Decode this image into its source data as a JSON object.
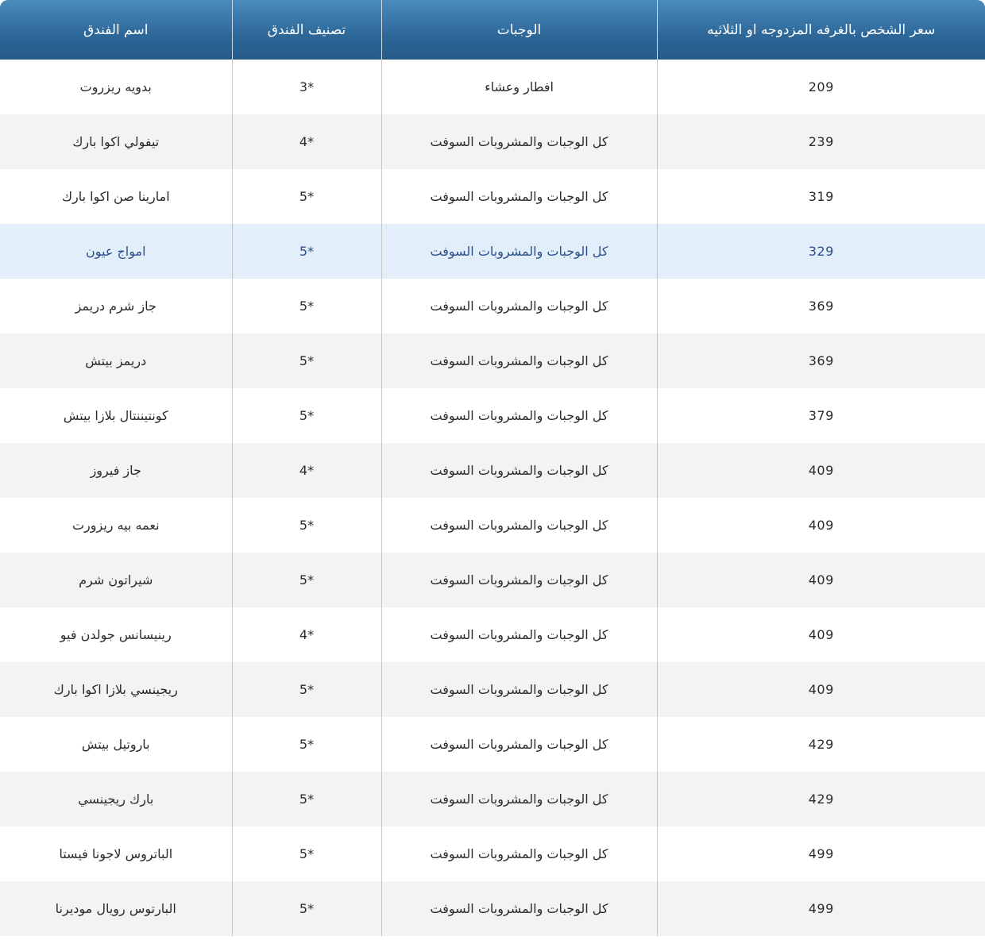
{
  "table": {
    "columns": [
      "سعر الشخص بالغرفه المزدوجه او الثلاثيه",
      "الوجبات",
      "تصنيف الفندق",
      "اسم الفندق"
    ],
    "highlighted_row": 3,
    "colors": {
      "header_top": "#4a8bbd",
      "header_bottom": "#245a88",
      "row_alt": "#f2f3f5",
      "row_highlight": "#e2eefa",
      "highlight_text": "#2a4f8a"
    },
    "rows": [
      {
        "price": "209",
        "meals": "افطار وعشاء",
        "rating": "3*",
        "hotel": "بدويه ريزروت"
      },
      {
        "price": "239",
        "meals": "كل الوجبات والمشروبات السوفت",
        "rating": "4*",
        "hotel": "تيفولي اكوا بارك"
      },
      {
        "price": "319",
        "meals": "كل الوجبات والمشروبات السوفت",
        "rating": "5*",
        "hotel": "امارينا صن اكوا بارك"
      },
      {
        "price": "329",
        "meals": "كل الوجبات والمشروبات السوفت",
        "rating": "5*",
        "hotel": "امواج عيون"
      },
      {
        "price": "369",
        "meals": "كل الوجبات والمشروبات السوفت",
        "rating": "5*",
        "hotel": "جاز شرم دريمز"
      },
      {
        "price": "369",
        "meals": "كل الوجبات والمشروبات السوفت",
        "rating": "5*",
        "hotel": "دريمز بيتش"
      },
      {
        "price": "379",
        "meals": "كل الوجبات والمشروبات السوفت",
        "rating": "5*",
        "hotel": "كونتيننتال بلازا بيتش"
      },
      {
        "price": "409",
        "meals": "كل الوجبات والمشروبات السوفت",
        "rating": "4*",
        "hotel": "جاز فيروز"
      },
      {
        "price": "409",
        "meals": "كل الوجبات والمشروبات السوفت",
        "rating": "5*",
        "hotel": "نعمه بيه ريزورت"
      },
      {
        "price": "409",
        "meals": "كل الوجبات والمشروبات السوفت",
        "rating": "5*",
        "hotel": "شيراتون شرم"
      },
      {
        "price": "409",
        "meals": "كل الوجبات والمشروبات السوفت",
        "rating": "4*",
        "hotel": "رينيسانس جولدن فيو"
      },
      {
        "price": "409",
        "meals": "كل الوجبات والمشروبات السوفت",
        "rating": "5*",
        "hotel": "ريجينسي بلازا اكوا بارك"
      },
      {
        "price": "429",
        "meals": "كل الوجبات والمشروبات السوفت",
        "rating": "5*",
        "hotel": "باروتيل بيتش"
      },
      {
        "price": "429",
        "meals": "كل الوجبات والمشروبات السوفت",
        "rating": "5*",
        "hotel": "بارك ريجينسي"
      },
      {
        "price": "499",
        "meals": "كل الوجبات والمشروبات السوفت",
        "rating": "5*",
        "hotel": "الباتروس لاجونا فيستا"
      },
      {
        "price": "499",
        "meals": "كل الوجبات والمشروبات السوفت",
        "rating": "5*",
        "hotel": "البارتوس رويال موديرنا"
      }
    ]
  }
}
